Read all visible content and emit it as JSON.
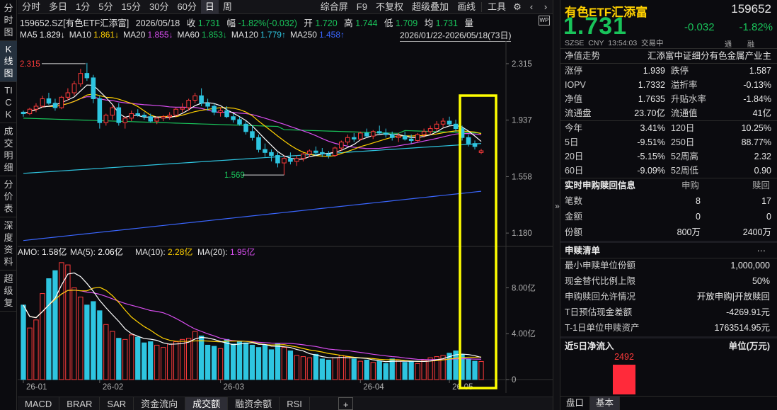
{
  "sidebar": [
    {
      "label": "分时图",
      "active": false
    },
    {
      "label": "K线图",
      "active": true
    },
    {
      "label": "TICK",
      "active": false
    },
    {
      "label": "成交明细",
      "active": false
    },
    {
      "label": "分价表",
      "active": false
    },
    {
      "label": "深度资料",
      "active": false
    },
    {
      "label": "超级复",
      "active": false
    }
  ],
  "toolbar": {
    "periods": [
      "分时",
      "多日",
      "1分",
      "5分",
      "15分",
      "30分",
      "60分",
      "日",
      "周"
    ],
    "active_period": "日",
    "tools": [
      "综合屏",
      "F9",
      "不复权",
      "超级叠加",
      "画线",
      "工具"
    ],
    "icons": [
      "gear-icon",
      "chevron-left-icon",
      "chevron-right-icon"
    ]
  },
  "quote_line": {
    "code_name": "159652.SZ[有色ETF汇添富]",
    "date": "2026/05/18",
    "close_label": "收",
    "close": "1.731",
    "change_label": "幅",
    "change": "-1.82%(-0.032)",
    "open_label": "开",
    "open": "1.720",
    "high_label": "高",
    "high": "1.744",
    "low_label": "低",
    "low": "1.709",
    "avg_label": "均",
    "avg": "1.731",
    "vol_label": "量",
    "wp_badge": "WP"
  },
  "ma_legend": [
    {
      "label": "MA5",
      "value": "1.829↓",
      "color": "#ffffff"
    },
    {
      "label": "MA10",
      "value": "1.861↓",
      "color": "#ffd000"
    },
    {
      "label": "MA20",
      "value": "1.855↓",
      "color": "#d94ef0"
    },
    {
      "label": "MA60",
      "value": "1.853↓",
      "color": "#19c35a"
    },
    {
      "label": "MA120",
      "value": "1.779↑",
      "color": "#2ec5e0"
    },
    {
      "label": "MA250",
      "value": "1.458↑",
      "color": "#3a66ff"
    }
  ],
  "date_range": "2026/01/22-2026/05/18(73日)",
  "price_axis": [
    "2.315",
    "1.937",
    "1.558",
    "1.180"
  ],
  "annotations": {
    "high_mark": "2.315",
    "low_mark": "1.569"
  },
  "amo_legend": [
    {
      "label": "AMO:",
      "value": "1.58亿",
      "color": "#ffffff"
    },
    {
      "label": "MA(5):",
      "value": "2.06亿",
      "color": "#ffffff"
    },
    {
      "label": "MA(10):",
      "value": "2.28亿",
      "color": "#ffd000"
    },
    {
      "label": "MA(20):",
      "value": "1.95亿",
      "color": "#d94ef0"
    }
  ],
  "volume_axis": [
    "8.00亿",
    "4.00亿",
    "0"
  ],
  "date_axis": [
    "26-01",
    "26-02",
    "26-03",
    "26-04",
    "26-05"
  ],
  "bottom_tabs": [
    "MACD",
    "BRAR",
    "SAR",
    "资金流向",
    "成交额",
    "融资余额",
    "RSI",
    "+"
  ],
  "active_bottom_tab": "成交额",
  "collapse_arrow": "»",
  "panel": {
    "name": "有色ETF汇添富",
    "code": "159652",
    "price": "1.731",
    "change": "-0.032",
    "change_pct": "-1.82%",
    "exchange": "SZSE",
    "currency": "CNY",
    "time": "13:54:03",
    "status": "交易中",
    "tags": [
      "通",
      "融"
    ],
    "nav_trend_label": "净值走势",
    "index_name": "汇添富中证细分有色金属产业主",
    "stats": [
      {
        "l1": "涨停",
        "v1": "1.939",
        "c1": "red",
        "l2": "跌停",
        "v2": "1.587",
        "c2": "grn"
      },
      {
        "l1": "IOPV",
        "v1": "1.7332",
        "c1": "wht",
        "l2": "溢折率",
        "v2": "-0.13%",
        "c2": "grn"
      },
      {
        "l1": "净值",
        "v1": "1.7635",
        "c1": "grn",
        "l2": "升贴水率",
        "v2": "-1.84%",
        "c2": "grn"
      },
      {
        "l1": "流通盘",
        "v1": "23.70亿",
        "c1": "wht",
        "l2": "流通值",
        "v2": "41亿",
        "c2": "wht"
      }
    ],
    "perf": [
      {
        "l1": "今年",
        "v1": "3.41%",
        "c1": "red",
        "l2": "120日",
        "v2": "10.25%",
        "c2": "red"
      },
      {
        "l1": "5日",
        "v1": "-9.51%",
        "c1": "grn",
        "l2": "250日",
        "v2": "88.77%",
        "c2": "red"
      },
      {
        "l1": "20日",
        "v1": "-5.15%",
        "c1": "grn",
        "l2": "52周高",
        "v2": "2.32",
        "c2": "wht"
      },
      {
        "l1": "60日",
        "v1": "-9.09%",
        "c1": "grn",
        "l2": "52周低",
        "v2": "0.90",
        "c2": "wht"
      }
    ],
    "sr_title": "实时申购赎回信息",
    "sr_col1": "申购",
    "sr_col2": "赎回",
    "sr_rows": [
      {
        "label": "笔数",
        "v1": "8",
        "v2": "17"
      },
      {
        "label": "金额",
        "v1": "0",
        "v2": "0"
      },
      {
        "label": "份额",
        "v1": "800万",
        "v2": "2400万"
      }
    ],
    "list_title": "申赎清单",
    "more": "···",
    "list_rows": [
      {
        "label": "最小申赎单位份额",
        "value": "1,000,000"
      },
      {
        "label": "现金替代比例上限",
        "value": "50%"
      },
      {
        "label": "申购赎回允许情况",
        "value": "开放申购|开放赎回"
      },
      {
        "label": "T日预估现金差额",
        "value": "-4269.91元"
      },
      {
        "label": "T-1日单位申赎资产",
        "value": "1763514.95元"
      }
    ],
    "flow_title": "近5日净流入",
    "flow_unit": "单位(万元)",
    "flow_value": 2492,
    "flow_value_label": "2492",
    "tabs": [
      "盘口",
      "基本"
    ],
    "active_tab": "基本"
  },
  "colors": {
    "up": "#ff3b3b",
    "down": "#2ec5e0",
    "ma5": "#ffffff",
    "ma10": "#ffd000",
    "ma20": "#d94ef0",
    "ma60": "#19c35a",
    "ma120": "#2ec5e0",
    "ma250": "#3a66ff",
    "highlight": "#ffff00"
  },
  "chart_data": {
    "type": "candlestick",
    "price_range": [
      1.1,
      2.4
    ],
    "candles_o_h_l_c": [
      [
        1.99,
        2.0,
        1.96,
        1.98
      ],
      [
        1.98,
        2.02,
        1.97,
        2.01
      ],
      [
        2.01,
        2.05,
        1.99,
        2.03
      ],
      [
        2.03,
        2.1,
        2.02,
        2.08
      ],
      [
        2.08,
        2.12,
        2.04,
        2.05
      ],
      [
        2.05,
        2.08,
        2.0,
        2.02
      ],
      [
        2.02,
        2.1,
        2.01,
        2.09
      ],
      [
        2.09,
        2.15,
        2.07,
        2.12
      ],
      [
        2.12,
        2.2,
        2.1,
        2.18
      ],
      [
        2.18,
        2.28,
        2.16,
        2.25
      ],
      [
        2.25,
        2.32,
        2.2,
        2.22
      ],
      [
        2.22,
        2.24,
        2.05,
        2.08
      ],
      [
        2.08,
        2.1,
        1.88,
        1.92
      ],
      [
        1.92,
        1.98,
        1.9,
        1.97
      ],
      [
        1.97,
        2.04,
        1.94,
        2.02
      ],
      [
        2.02,
        2.05,
        1.9,
        1.92
      ],
      [
        1.92,
        1.96,
        1.88,
        1.95
      ],
      [
        1.95,
        2.0,
        1.93,
        1.98
      ],
      [
        1.98,
        2.01,
        1.96,
        1.97
      ],
      [
        1.97,
        1.99,
        1.94,
        1.96
      ],
      [
        1.96,
        1.98,
        1.92,
        1.93
      ],
      [
        1.93,
        1.96,
        1.91,
        1.95
      ],
      [
        1.95,
        1.97,
        1.93,
        1.96
      ],
      [
        1.96,
        1.99,
        1.94,
        1.97
      ],
      [
        1.97,
        2.02,
        1.96,
        2.01
      ],
      [
        2.01,
        2.05,
        1.99,
        2.02
      ],
      [
        2.02,
        2.08,
        2.0,
        2.07
      ],
      [
        2.07,
        2.12,
        2.05,
        2.1
      ],
      [
        2.1,
        2.15,
        2.03,
        2.05
      ],
      [
        2.05,
        2.08,
        2.0,
        2.03
      ],
      [
        2.03,
        2.05,
        1.97,
        1.99
      ],
      [
        1.99,
        2.02,
        1.96,
        2.0
      ],
      [
        2.0,
        2.03,
        1.95,
        1.96
      ],
      [
        1.96,
        1.98,
        1.92,
        1.94
      ],
      [
        1.94,
        1.96,
        1.9,
        1.91
      ],
      [
        1.91,
        1.93,
        1.84,
        1.86
      ],
      [
        1.86,
        1.9,
        1.8,
        1.82
      ],
      [
        1.82,
        1.84,
        1.72,
        1.74
      ],
      [
        1.74,
        1.78,
        1.69,
        1.72
      ],
      [
        1.72,
        1.74,
        1.66,
        1.7
      ],
      [
        1.7,
        1.72,
        1.62,
        1.65
      ],
      [
        1.65,
        1.7,
        1.57,
        1.68
      ],
      [
        1.68,
        1.72,
        1.64,
        1.66
      ],
      [
        1.66,
        1.7,
        1.63,
        1.68
      ],
      [
        1.68,
        1.72,
        1.66,
        1.71
      ],
      [
        1.71,
        1.74,
        1.69,
        1.73
      ],
      [
        1.73,
        1.76,
        1.7,
        1.72
      ],
      [
        1.72,
        1.75,
        1.69,
        1.71
      ],
      [
        1.71,
        1.73,
        1.68,
        1.7
      ],
      [
        1.7,
        1.76,
        1.69,
        1.75
      ],
      [
        1.75,
        1.8,
        1.73,
        1.79
      ],
      [
        1.79,
        1.84,
        1.77,
        1.82
      ],
      [
        1.82,
        1.85,
        1.79,
        1.81
      ],
      [
        1.81,
        1.86,
        1.8,
        1.85
      ],
      [
        1.85,
        1.88,
        1.82,
        1.83
      ],
      [
        1.83,
        1.87,
        1.81,
        1.86
      ],
      [
        1.86,
        1.9,
        1.84,
        1.85
      ],
      [
        1.85,
        1.88,
        1.82,
        1.84
      ],
      [
        1.84,
        1.86,
        1.8,
        1.82
      ],
      [
        1.82,
        1.85,
        1.79,
        1.83
      ],
      [
        1.83,
        1.86,
        1.8,
        1.81
      ],
      [
        1.81,
        1.84,
        1.78,
        1.8
      ],
      [
        1.8,
        1.85,
        1.79,
        1.84
      ],
      [
        1.84,
        1.88,
        1.82,
        1.86
      ],
      [
        1.86,
        1.9,
        1.84,
        1.88
      ],
      [
        1.88,
        1.93,
        1.86,
        1.91
      ],
      [
        1.91,
        1.95,
        1.89,
        1.93
      ],
      [
        1.93,
        1.96,
        1.9,
        1.91
      ],
      [
        1.91,
        1.94,
        1.86,
        1.88
      ],
      [
        1.88,
        1.9,
        1.8,
        1.82
      ],
      [
        1.82,
        1.84,
        1.76,
        1.78
      ],
      [
        1.78,
        1.8,
        1.74,
        1.76
      ],
      [
        1.72,
        1.744,
        1.709,
        1.731
      ]
    ],
    "amount_yi": [
      6.5,
      4.5,
      5.2,
      7.5,
      8.8,
      9.5,
      10.2,
      10.0,
      8.0,
      7.2,
      6.5,
      6.8,
      6.0,
      4.8,
      4.2,
      3.6,
      3.5,
      3.9,
      3.7,
      3.2,
      3.3,
      3.0,
      2.8,
      3.1,
      3.3,
      3.5,
      3.6,
      4.2,
      3.8,
      3.0,
      2.9,
      2.7,
      3.5,
      3.1,
      3.3,
      3.2,
      3.0,
      2.8,
      3.0,
      2.6,
      3.1,
      2.8,
      2.5,
      2.1,
      2.0,
      1.9,
      2.2,
      1.8,
      1.7,
      1.9,
      2.1,
      2.0,
      1.8,
      1.6,
      1.7,
      1.5,
      1.6,
      1.4,
      1.8,
      1.7,
      1.5,
      1.6,
      1.4,
      1.7,
      1.9,
      2.0,
      2.1,
      2.3,
      2.5,
      2.2,
      1.8,
      1.6,
      1.58
    ],
    "amount_range_yi": [
      0,
      10.5
    ]
  }
}
